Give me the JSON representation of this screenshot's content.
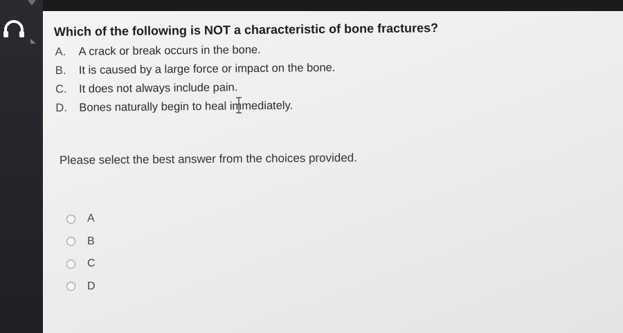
{
  "question": {
    "text": "Which of the following is NOT a characteristic of bone fractures?",
    "choices": [
      {
        "letter": "A.",
        "text": "A crack or break occurs in the bone."
      },
      {
        "letter": "B.",
        "text": "It is caused by a large force or impact on the bone."
      },
      {
        "letter": "C.",
        "text": "It does not always include pain."
      },
      {
        "letter": "D.",
        "text": "Bones naturally begin to heal immediately."
      }
    ]
  },
  "prompt": "Please select the best answer from the choices provided.",
  "answer_options": [
    {
      "label": "A",
      "selected": false
    },
    {
      "label": "B",
      "selected": false
    },
    {
      "label": "C",
      "selected": false
    },
    {
      "label": "D",
      "selected": false
    }
  ],
  "icons": {
    "audio": "headphones-icon",
    "cursor": "text-cursor-icon"
  },
  "colors": {
    "panel_background": "#ececec",
    "question_text": "#1d1d1d",
    "radio_border": "#9a9a9a"
  }
}
